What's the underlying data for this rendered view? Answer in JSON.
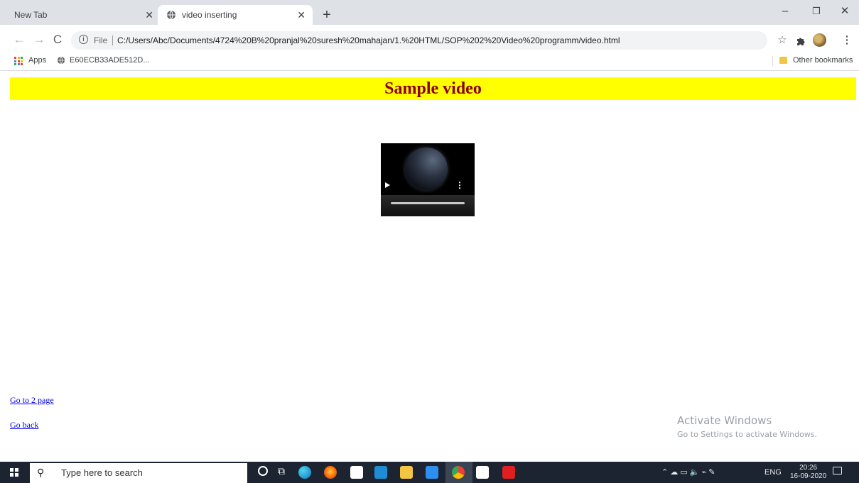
{
  "browser": {
    "tabs": [
      {
        "label": "New Tab",
        "active": false
      },
      {
        "label": "video inserting",
        "active": true
      }
    ],
    "new_tab_glyph": "+",
    "window_controls": {
      "minimize": "–",
      "restore": "❐",
      "close": "✕"
    },
    "address": {
      "scheme_label": "File",
      "url": "C:/Users/Abc/Documents/4724%20B%20pranjal%20suresh%20mahajan/1.%20HTML/SOP%202%20Video%20programm/video.html"
    },
    "bookmarks": {
      "apps_label": "Apps",
      "items": [
        {
          "label": "E60ECB33ADE512D..."
        }
      ],
      "other_label": "Other bookmarks"
    },
    "icons": [
      "back-arrow-icon",
      "forward-arrow-icon",
      "reload-icon",
      "info-icon",
      "star-icon",
      "extensions-puzzle-icon",
      "profile-avatar",
      "kebab-menu-icon",
      "globe-icon",
      "apps-grid-icon",
      "folder-icon"
    ]
  },
  "page": {
    "heading": "Sample video",
    "colors": {
      "banner_bg": "#ffff00",
      "heading_text": "#8b0000",
      "link": "#0000ee"
    },
    "video": {
      "controls": [
        "play-icon",
        "more-options-icon",
        "progress-bar"
      ]
    },
    "links": [
      {
        "label": "Go to 2 page"
      },
      {
        "label": "Go back"
      }
    ]
  },
  "watermark": {
    "title": "Activate Windows",
    "subtitle": "Go to Settings to activate Windows."
  },
  "taskbar": {
    "search_placeholder": "Type here to search",
    "tray_language": "ENG",
    "time": "20:26",
    "date": "16-09-2020"
  }
}
